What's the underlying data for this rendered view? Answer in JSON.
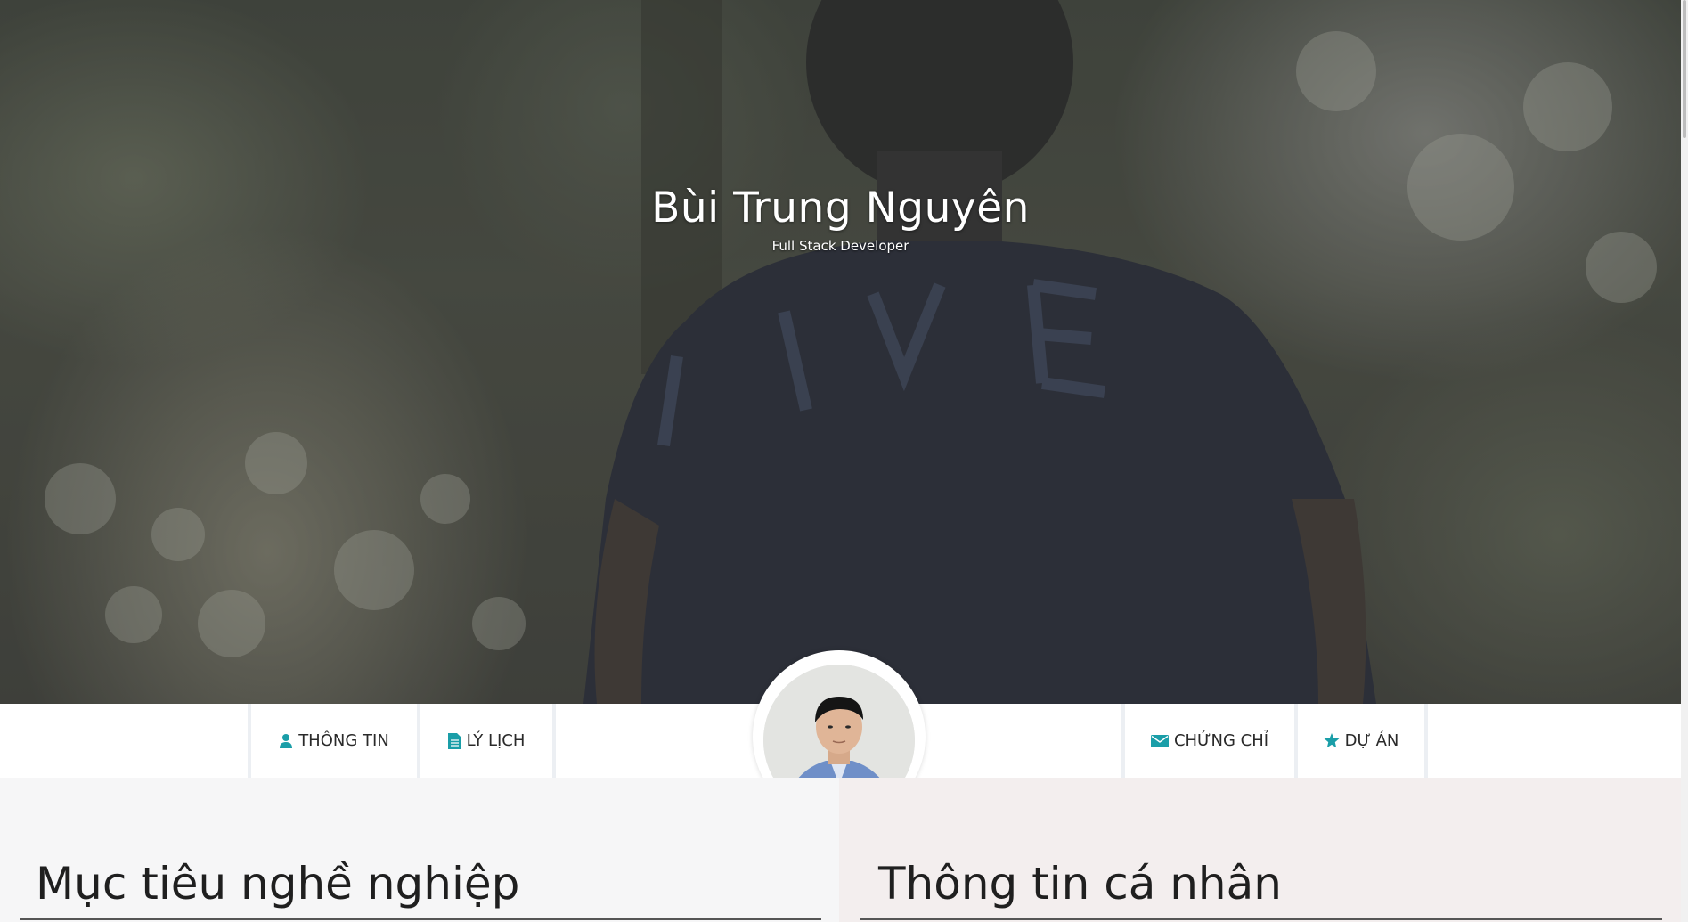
{
  "hero": {
    "title": "Bùi Trung Nguyên",
    "subtitle": "Full Stack Developer"
  },
  "nav": {
    "items": [
      {
        "label": "THÔNG TIN",
        "icon": "user-icon"
      },
      {
        "label": "LÝ LỊCH",
        "icon": "document-icon"
      },
      {
        "label": "CHỨNG CHỈ",
        "icon": "envelope-icon"
      },
      {
        "label": "DỰ ÁN",
        "icon": "star-icon"
      }
    ],
    "icon_color": "#1a9ea8"
  },
  "sections": {
    "left_title": "Mục tiêu nghề nghiệp",
    "right_title": "Thông tin cá nhân"
  }
}
